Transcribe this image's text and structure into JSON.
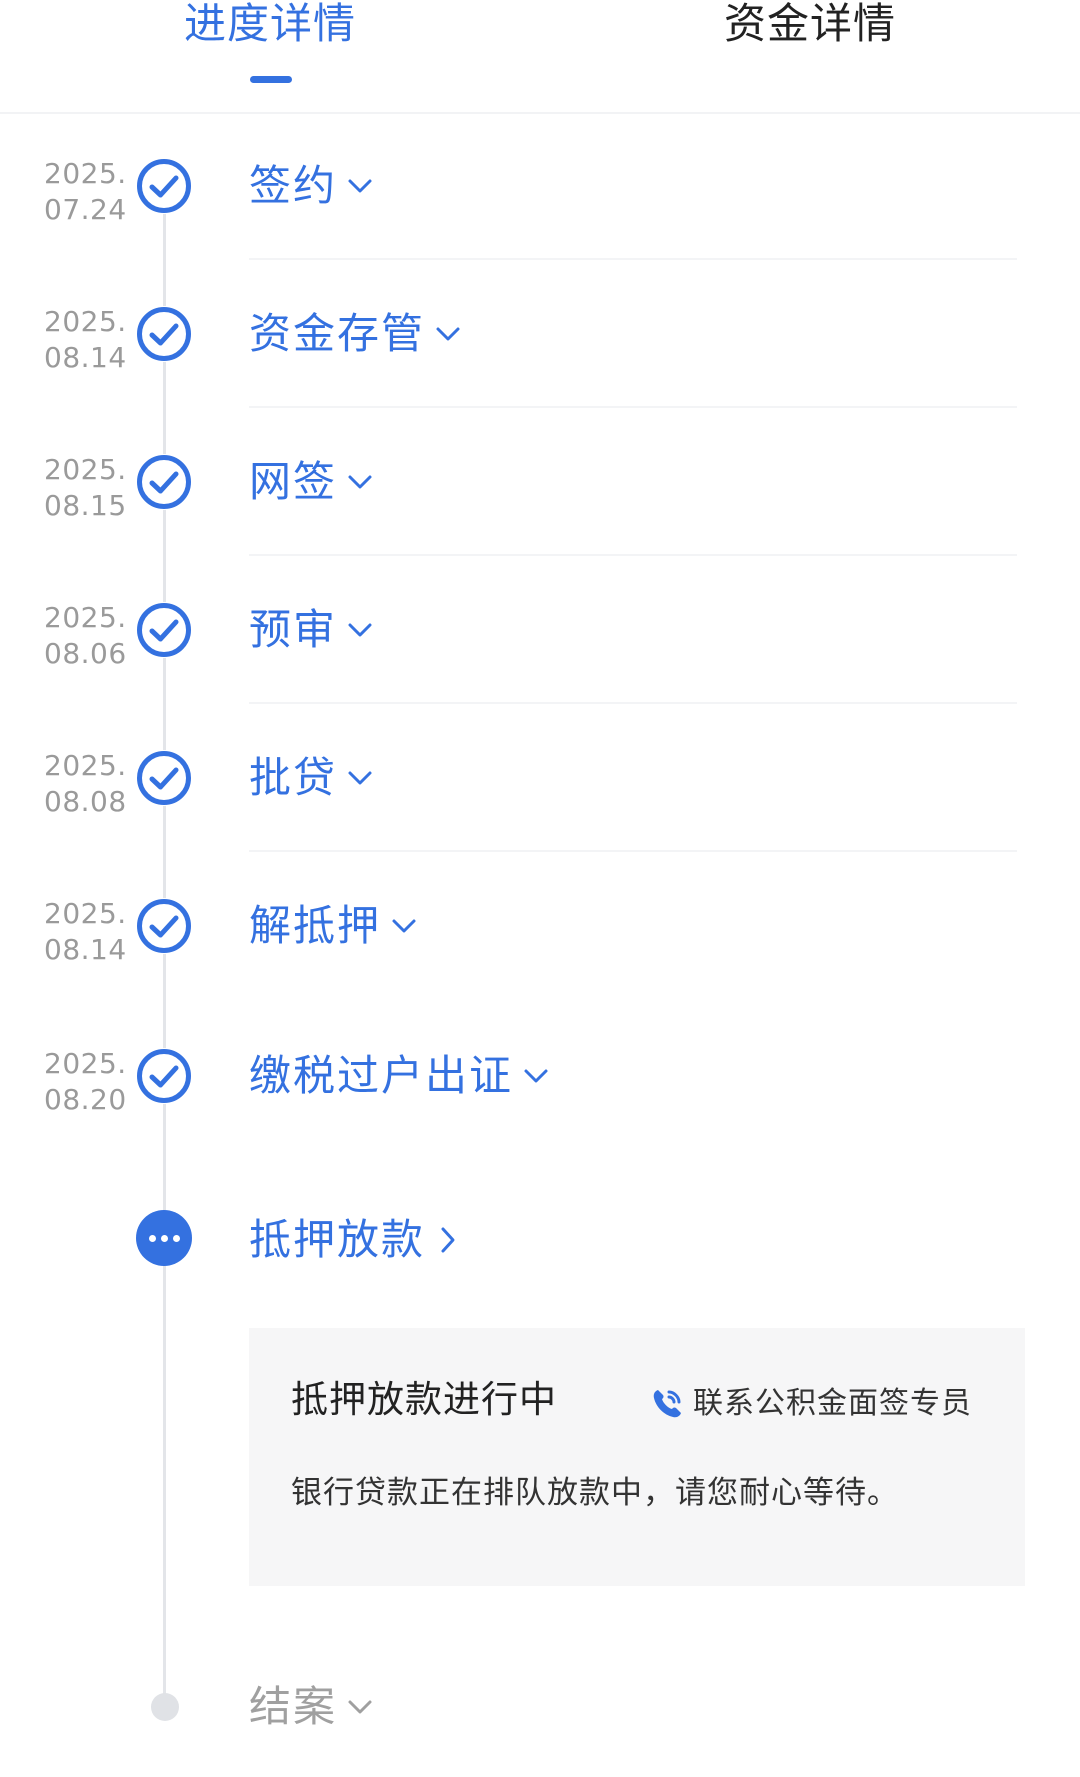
{
  "tabs": [
    {
      "label": "进度详情",
      "active": true
    },
    {
      "label": "资金详情",
      "active": false
    }
  ],
  "colors": {
    "accent": "#3471e0",
    "timeline_line": "#e3e5e9",
    "pending": "#e0e2e6",
    "card_bg": "#f6f6f7",
    "date_text": "#9a9a9a"
  },
  "steps": [
    {
      "year": "2025.",
      "date": "07.24",
      "title": "签约",
      "status": "done",
      "icon": "check-circle-icon",
      "chevron": "chevron-down-icon"
    },
    {
      "year": "2025.",
      "date": "08.14",
      "title": "资金存管",
      "status": "done",
      "icon": "check-circle-icon",
      "chevron": "chevron-down-icon"
    },
    {
      "year": "2025.",
      "date": "08.15",
      "title": "网签",
      "status": "done",
      "icon": "check-circle-icon",
      "chevron": "chevron-down-icon"
    },
    {
      "year": "2025.",
      "date": "08.06",
      "title": "预审",
      "status": "done",
      "icon": "check-circle-icon",
      "chevron": "chevron-down-icon"
    },
    {
      "year": "2025.",
      "date": "08.08",
      "title": "批贷",
      "status": "done",
      "icon": "check-circle-icon",
      "chevron": "chevron-down-icon"
    },
    {
      "year": "2025.",
      "date": "08.14",
      "title": "解抵押",
      "status": "done",
      "icon": "check-circle-icon",
      "chevron": "chevron-down-icon"
    },
    {
      "year": "2025.",
      "date": "08.20",
      "title": "缴税过户出证",
      "status": "done",
      "icon": "check-circle-icon",
      "chevron": "chevron-down-icon"
    }
  ],
  "active_step": {
    "title": "抵押放款",
    "status": "in-progress",
    "icon": "more-dots-icon",
    "chevron": "chevron-right-icon",
    "card": {
      "title": "抵押放款进行中",
      "contact_icon": "phone-icon",
      "contact_label": "联系公积金面签专员",
      "description": "银行贷款正在排队放款中，请您耐心等待。"
    }
  },
  "pending_step": {
    "title": "结案",
    "status": "pending",
    "chevron": "chevron-down-icon"
  }
}
